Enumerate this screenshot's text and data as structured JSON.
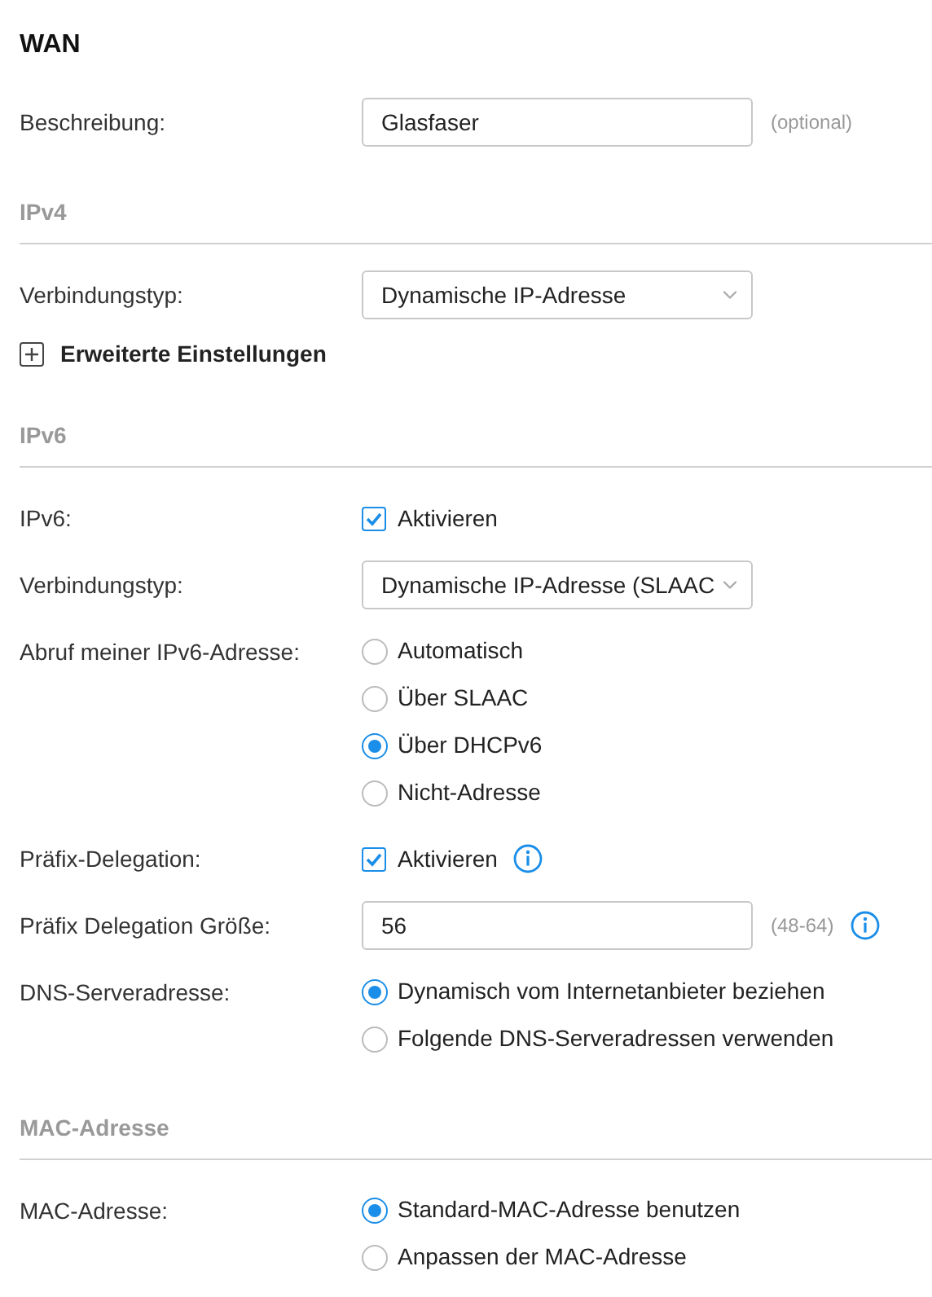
{
  "title": "WAN",
  "sections": [
    {
      "rows": [
        {
          "kind": "text",
          "label": "Beschreibung:",
          "value": "Glasfaser",
          "hint": "(optional)"
        }
      ]
    },
    {
      "heading": "IPv4",
      "rows": [
        {
          "kind": "select",
          "label": "Verbindungstyp:",
          "value": "Dynamische IP-Adresse"
        },
        {
          "kind": "expander",
          "label": "Erweiterte Einstellungen",
          "expanded": false
        }
      ]
    },
    {
      "heading": "IPv6",
      "rows": [
        {
          "kind": "checkbox",
          "label": "IPv6:",
          "text": "Aktivieren",
          "checked": true
        },
        {
          "kind": "select",
          "label": "Verbindungstyp:",
          "value": "Dynamische IP-Adresse (SLAAC"
        },
        {
          "kind": "radios",
          "label": "Abruf meiner IPv6-Adresse:",
          "options": [
            {
              "text": "Automatisch",
              "selected": false
            },
            {
              "text": "Über SLAAC",
              "selected": false
            },
            {
              "text": "Über DHCPv6",
              "selected": true
            },
            {
              "text": "Nicht-Adresse",
              "selected": false
            }
          ]
        },
        {
          "kind": "checkbox",
          "label": "Präfix-Delegation:",
          "text": "Aktivieren",
          "checked": true,
          "info": true
        },
        {
          "kind": "text",
          "label": "Präfix Delegation Größe:",
          "value": "56",
          "hint": "(48-64)",
          "info": true
        },
        {
          "kind": "radios",
          "label": "DNS-Serveradresse:",
          "options": [
            {
              "text": "Dynamisch vom Internetanbieter beziehen",
              "selected": true
            },
            {
              "text": "Folgende DNS-Serveradressen verwenden",
              "selected": false
            }
          ]
        }
      ]
    },
    {
      "heading": "MAC-Adresse",
      "rows": [
        {
          "kind": "radios",
          "label": "MAC-Adresse:",
          "options": [
            {
              "text": "Standard-MAC-Adresse benutzen",
              "selected": true
            },
            {
              "text": "Anpassen der MAC-Adresse",
              "selected": false
            }
          ]
        }
      ]
    }
  ]
}
